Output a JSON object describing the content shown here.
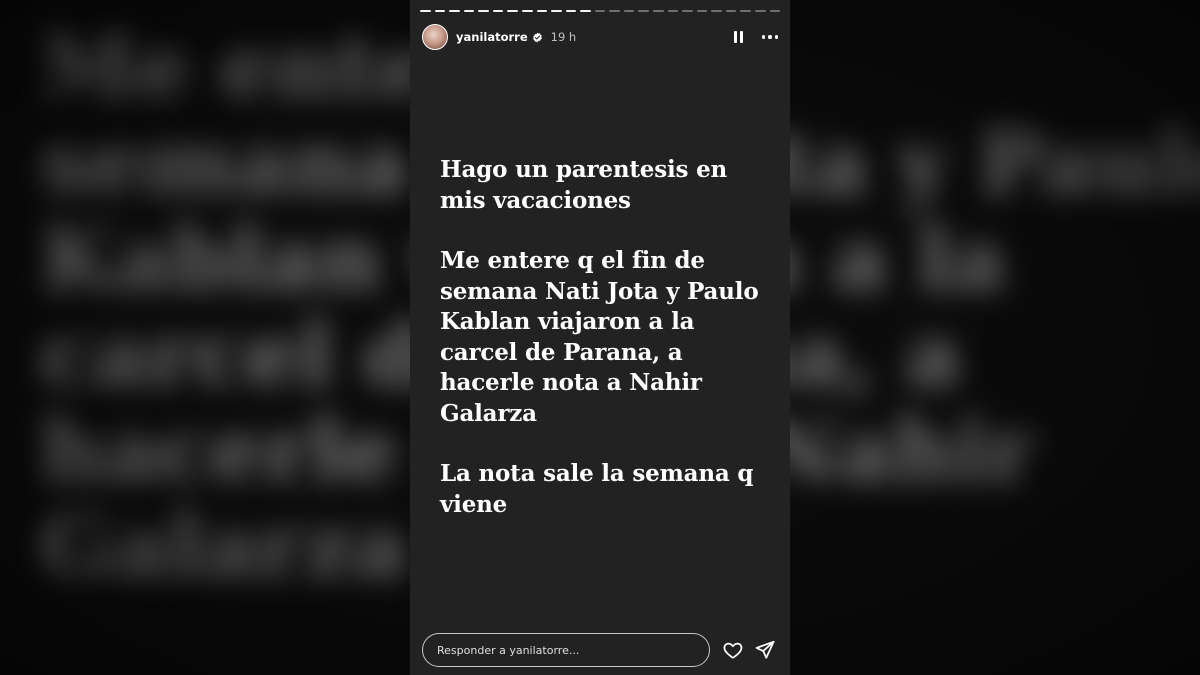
{
  "story": {
    "username": "yanilatorre",
    "time": "19 h",
    "paragraphs": [
      "Hago un parentesis en\nmis vacaciones",
      "Me entere q el fin de\nsemana Nati Jota y Paulo\nKablan viajaron a la\ncarcel de Parana, a\nhacerle nota a Nahir\nGalarza",
      "La nota sale la semana q\nviene"
    ],
    "progress": {
      "segments_total": 25,
      "segments_done": 12
    }
  },
  "reply": {
    "placeholder": "Responder a yanilatorre..."
  },
  "icons": {
    "verified": "verified-badge-icon",
    "pause": "pause-icon",
    "more": "more-options-icon",
    "like": "heart-icon",
    "share": "send-icon"
  },
  "colors": {
    "story_background": "#222222",
    "page_background": "#0b0b0b",
    "text": "#ffffff",
    "verified": "#ffffff"
  }
}
